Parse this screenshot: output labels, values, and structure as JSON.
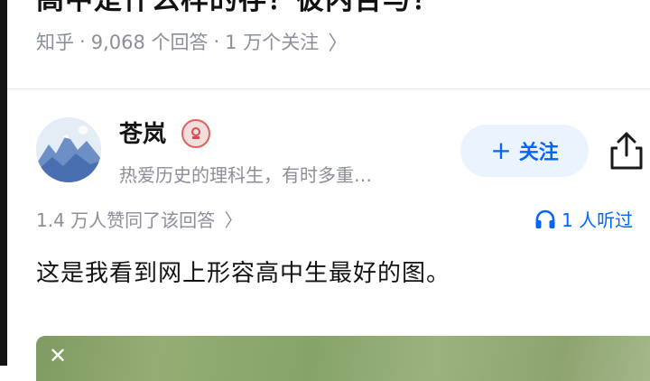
{
  "question": {
    "title_fragment": "高中是什么样的存？彼内告与？",
    "source": "知乎",
    "answer_count": "9,068 个回答",
    "follower_count": "1 万个关注",
    "chevron": "〉"
  },
  "author": {
    "name": "苍岚",
    "bio": "热爱历史的理科生，有时多重…",
    "follow_label": "关注",
    "follow_icon": "plus-icon",
    "share_icon": "share-icon"
  },
  "answer": {
    "likes_text": "1.4 万人赞同了该回答",
    "likes_chevron": "〉",
    "listen_text": "1 人听过",
    "listen_icon": "headphones-icon",
    "content": "这是我看到网上形容高中生最好的图。"
  },
  "colors": {
    "accent": "#0066ff",
    "muted_text": "#8a8f99",
    "follow_bg": "#ebf3ff"
  }
}
